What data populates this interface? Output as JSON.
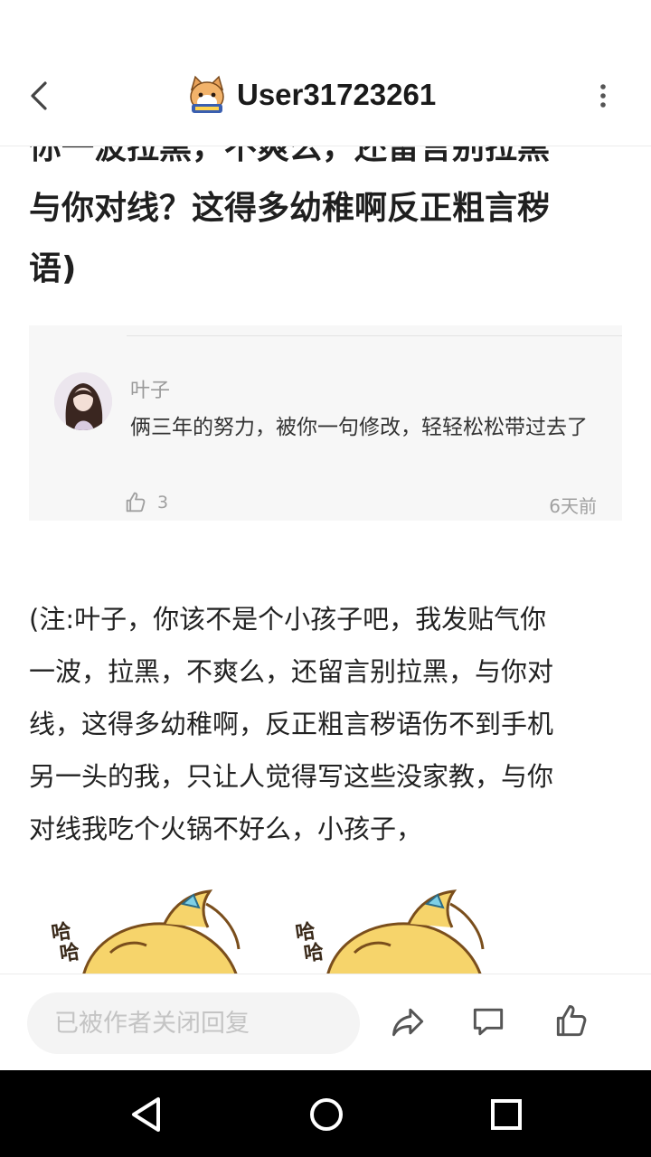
{
  "header": {
    "title": "User31723261",
    "back_icon": "chevron-left-icon",
    "avatar_icon": "cat-avatar-icon",
    "more_icon": "more-vertical-icon"
  },
  "post": {
    "heading_lines": [
      "你一波拉黑，不爽么，还留言别拉黑",
      "与你对线？这得多幼稚啊反正粗言秽",
      "语)"
    ]
  },
  "quoted_comment": {
    "author": "叶子",
    "text": "俩三年的努力，被你一句修改，轻轻松松带过去了",
    "likes": "3",
    "time": "6天前",
    "like_icon": "thumbs-up-icon"
  },
  "note": {
    "lines": [
      "(注:叶子，你该不是个小孩子吧，我发贴气你",
      "一波，拉黑，不爽么，还留言别拉黑，与你对",
      "线，这得多幼稚啊，反正粗言秽语伤不到手机",
      "另一头的我，只让人觉得写这些没家教，与你",
      "对线我吃个火锅不好么，小孩子，"
    ]
  },
  "sticker": {
    "text": "哈哈"
  },
  "bottom_bar": {
    "reply_placeholder": "已被作者关闭回复",
    "share_icon": "share-icon",
    "comment_icon": "comment-icon",
    "like_icon": "thumbs-up-icon"
  },
  "nav": {
    "back_icon": "nav-back-icon",
    "home_icon": "nav-home-icon",
    "recents_icon": "nav-recents-icon"
  },
  "colors": {
    "background": "#ffffff",
    "muted_text": "#9a9a9a",
    "quote_bg": "#f7f7f7",
    "nav_bg": "#000000"
  }
}
